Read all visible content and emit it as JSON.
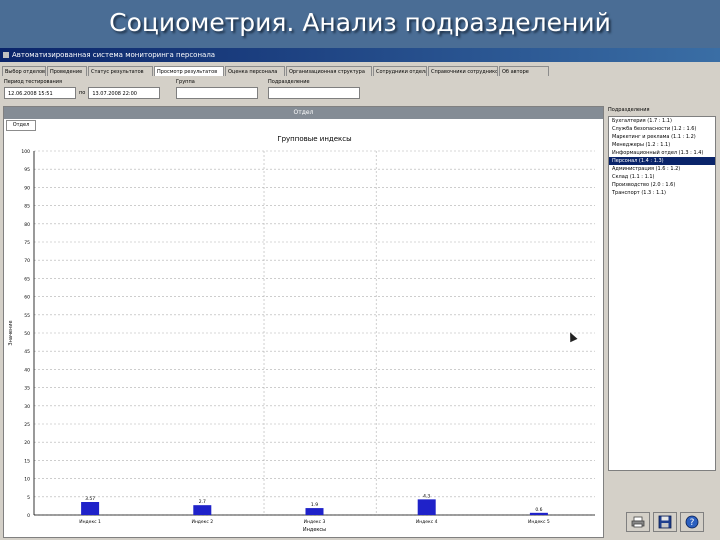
{
  "slide_title": "Социометрия. Анализ подразделений",
  "window": {
    "title": "Автоматизированная система мониторинга персонала"
  },
  "tabs": [
    {
      "label": "Выбор отделов",
      "active": false
    },
    {
      "label": "Проведение",
      "active": false
    },
    {
      "label": "Статус результатов",
      "active": false
    },
    {
      "label": "Просмотр результатов",
      "active": true
    },
    {
      "label": "Оценка персонала",
      "active": false
    },
    {
      "label": "Организационная структура",
      "active": false
    },
    {
      "label": "Сотрудники отдела",
      "active": false
    },
    {
      "label": "Справочники сотрудников",
      "active": false
    },
    {
      "label": "Об авторе",
      "active": false
    }
  ],
  "filters": {
    "date_label": "Период тестирования",
    "date_from": "12.06.2008 15:51",
    "date_to_prefix": "по",
    "date_to": "13.07.2008 22:00",
    "field2_label": "Группа",
    "field3_label": "Подразделение"
  },
  "chart_panel": {
    "header": "Отдел",
    "subtab": "Отдел"
  },
  "side": {
    "title": "Подразделения",
    "items": [
      {
        "label": "Бухгалтерия (1.7 : 1.1)",
        "selected": false
      },
      {
        "label": "Служба безопасности (1.2 : 1.6)",
        "selected": false
      },
      {
        "label": "Маркетинг и реклама (1.1 : 1.2)",
        "selected": false
      },
      {
        "label": "Менеджеры (1.2 : 1.1)",
        "selected": false
      },
      {
        "label": "Информационный отдел (1.3 : 1.4)",
        "selected": false
      },
      {
        "label": "Персонал (1.4 : 1.3)",
        "selected": true
      },
      {
        "label": "Администрация (1.6 : 1.2)",
        "selected": false
      },
      {
        "label": "Склад (1.1 : 1.1)",
        "selected": false
      },
      {
        "label": "Производство (2.0 : 1.6)",
        "selected": false
      },
      {
        "label": "Транспорт (1.3 : 1.1)",
        "selected": false
      }
    ]
  },
  "buttons": {
    "print_icon": "printer-icon",
    "save_icon": "save-icon",
    "help_icon": "help-icon"
  },
  "chart_data": {
    "type": "bar",
    "title": "Групповые индексы",
    "xlabel": "Индексы",
    "ylabel": "Значение",
    "ylim": [
      0,
      100
    ],
    "yticks": [
      0,
      5,
      10,
      15,
      20,
      25,
      30,
      35,
      40,
      45,
      50,
      55,
      60,
      65,
      70,
      75,
      80,
      85,
      90,
      95,
      100
    ],
    "grid": true,
    "categories": [
      "Индекс 1",
      "Индекс 2",
      "Индекс 3",
      "Индекс 4",
      "Индекс 5"
    ],
    "values": [
      3.57,
      2.7,
      1.9,
      4.3,
      0.6
    ],
    "value_labels": [
      "3.57",
      "2.7",
      "1.9",
      "4.3",
      "0.6"
    ],
    "bar_color": "#1f22c9"
  },
  "colors": {
    "slide_background": "#4a6d95",
    "window_titlebar": "#0a246a",
    "selected_item": "#0a246a"
  }
}
